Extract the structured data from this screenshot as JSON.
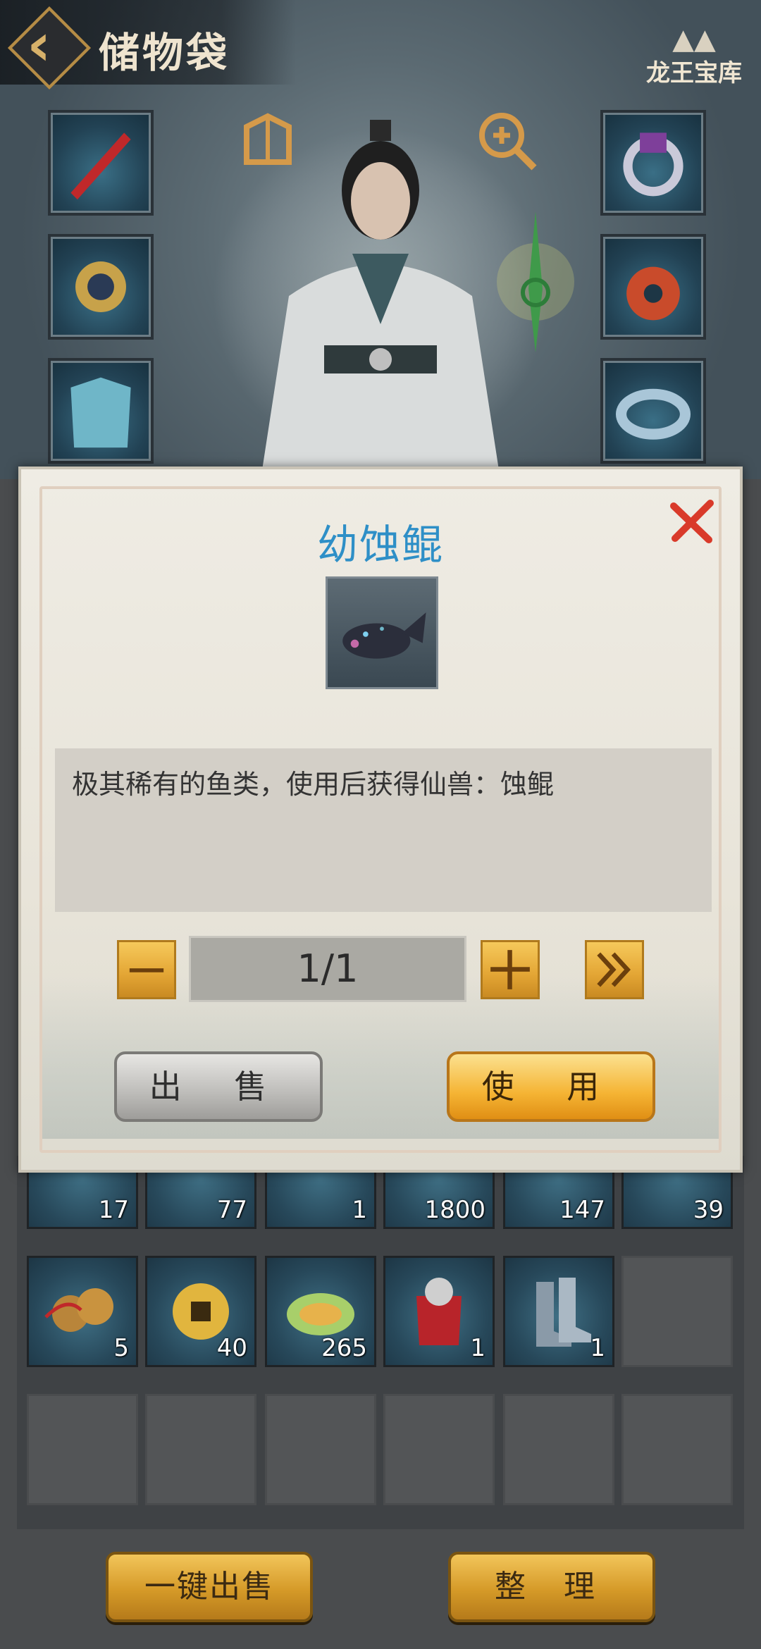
{
  "header": {
    "title": "储物袋",
    "treasury_label": "龙王宝库"
  },
  "dialog": {
    "item_name": "幼蚀鲲",
    "description": "极其稀有的鱼类，使用后获得仙兽：蚀鲲",
    "quantity": "1/1",
    "sell_label": "出 售",
    "use_label": "使 用"
  },
  "inventory": {
    "row1": [
      "17",
      "77",
      "1",
      "1800",
      "147",
      "39"
    ],
    "row2": [
      "5",
      "40",
      "265",
      "1",
      "1"
    ]
  },
  "bottom": {
    "sell_all_label": "一键出售",
    "sort_label": "整 理"
  },
  "colors": {
    "title_blue": "#2e8fc7",
    "gold": "#e3a534",
    "close_red": "#d93a2a"
  }
}
